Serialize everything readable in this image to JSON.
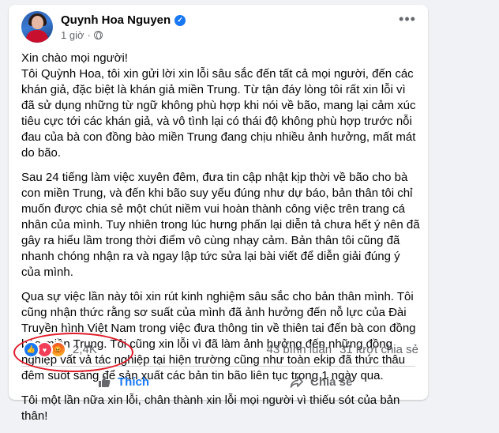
{
  "post": {
    "author": "Quynh Hoa Nguyen",
    "time": "1 giờ",
    "more_icon": "ellipsis-icon",
    "paragraphs": [
      "Xin chào mọi người!\nTôi Quỳnh Hoa, tôi xin gửi lời xin lỗi sâu sắc đến tất cả mọi người, đến các khán giả, đặc biệt là khán giả miền Trung. Từ tận đáy lòng tôi rất xin lỗi vì đã sử dụng những từ ngữ không phù hợp khi nói về bão, mang lại cảm xúc tiêu cực tới các khán giả, và vô tình lại có thái độ không phù hợp trước nỗi đau của bà con đồng bào miền Trung đang chịu nhiều ảnh hưởng, mất mát do bão.",
      "Sau 24 tiếng làm việc xuyên đêm, đưa tin cập nhật kịp thời về bão cho bà con miền Trung, và đến khi bão suy yếu đúng như dự báo, bản thân tôi chỉ muốn được chia sẻ một chút niềm vui hoàn thành công việc trên trang cá nhân của mình. Tuy nhiên trong lúc hưng phấn lại diễn tả chưa hết ý nên đã gây ra hiểu lầm trong thời điểm vô cùng nhạy cảm. Bản thân tôi cũng đã nhanh chóng nhận ra và ngay lập tức sửa lại bài viết để diễn giải đúng ý của mình.",
      "Qua sự việc lần này tôi xin rút kinh nghiệm sâu sắc cho bản thân mình. Tôi cũng nhận thức rằng sơ suất của mình đã ảnh hưởng đến nỗ lực của Đài Truyền hình Việt Nam trong việc đưa thông tin về thiên tai đến bà con đồng bào miền Trung. Tôi cũng xin lỗi vì đã làm ảnh hưởng đến những đồng nghiệp vất vả tác nghiệp tại hiện trường cũng như toàn ekip đã thức thâu đêm suốt sáng để sản xuất các bản tin bão liên tục trong 1 ngày qua.",
      "Tôi một lần nữa xin lỗi, chân thành xin lỗi mọi người vì thiếu sót của bản thân!"
    ]
  },
  "reactions": {
    "count": "2,4K",
    "types": [
      "like",
      "love",
      "angry"
    ]
  },
  "stats": {
    "comments": "43 bình luận",
    "shares": "31 lượt chia sẻ"
  },
  "actions": {
    "like_label": "Thích",
    "share_label": "Chia sẻ"
  },
  "colors": {
    "accent": "#1877f2",
    "highlight": "#e11b2a"
  }
}
